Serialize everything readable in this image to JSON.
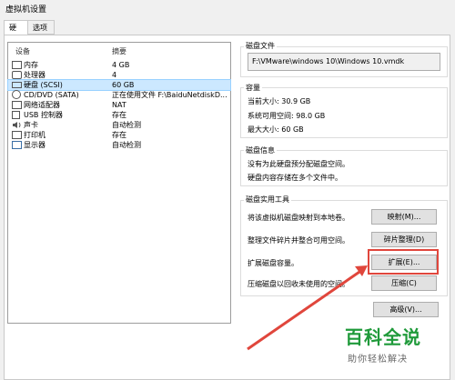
{
  "window": {
    "title": "虚拟机设置"
  },
  "tabs": [
    {
      "label": "硬件"
    },
    {
      "label": "选项"
    }
  ],
  "device_table": {
    "col_device": "设备",
    "col_summary": "摘要",
    "rows": [
      {
        "name": "内存",
        "summary": "4 GB",
        "icon": "memory-icon"
      },
      {
        "name": "处理器",
        "summary": "4",
        "icon": "processor-icon"
      },
      {
        "name": "硬盘 (SCSI)",
        "summary": "60 GB",
        "icon": "hard-disk-icon"
      },
      {
        "name": "CD/DVD (SATA)",
        "summary": "正在使用文件 F:\\BaiduNetdiskD...",
        "icon": "cd-dvd-icon"
      },
      {
        "name": "网络适配器",
        "summary": "NAT",
        "icon": "network-adapter-icon"
      },
      {
        "name": "USB 控制器",
        "summary": "存在",
        "icon": "usb-icon"
      },
      {
        "name": "声卡",
        "summary": "自动检测",
        "icon": "sound-card-icon"
      },
      {
        "name": "打印机",
        "summary": "存在",
        "icon": "printer-icon"
      },
      {
        "name": "显示器",
        "summary": "自动检测",
        "icon": "display-icon"
      }
    ]
  },
  "disk_file": {
    "label": "磁盘文件",
    "path": "F:\\VMware\\windows 10\\Windows 10.vmdk"
  },
  "capacity": {
    "label": "容量",
    "current": "当前大小: 30.9 GB",
    "free": "系统可用空间: 98.0 GB",
    "max": "最大大小: 60 GB"
  },
  "disk_info": {
    "label": "磁盘信息",
    "line1": "没有为此硬盘预分配磁盘空间。",
    "line2": "硬盘内容存储在多个文件中。"
  },
  "utilities": {
    "label": "磁盘实用工具",
    "map_text": "将该虚拟机磁盘映射到本地卷。",
    "map_btn": "映射(M)...",
    "defrag_text": "整理文件碎片并整合可用空间。",
    "defrag_btn": "碎片整理(D)",
    "expand_text": "扩展磁盘容量。",
    "expand_btn": "扩展(E)...",
    "compact_text": "压缩磁盘以回收未使用的空间。",
    "compact_btn": "压缩(C)"
  },
  "advanced_btn": "高级(V)...",
  "watermark": {
    "brand": "百科全说",
    "tagline": "助你轻松解决"
  },
  "colors": {
    "selection": "#cce8ff",
    "annotation": "#e0463c",
    "watermark": "#1f9a3a"
  }
}
